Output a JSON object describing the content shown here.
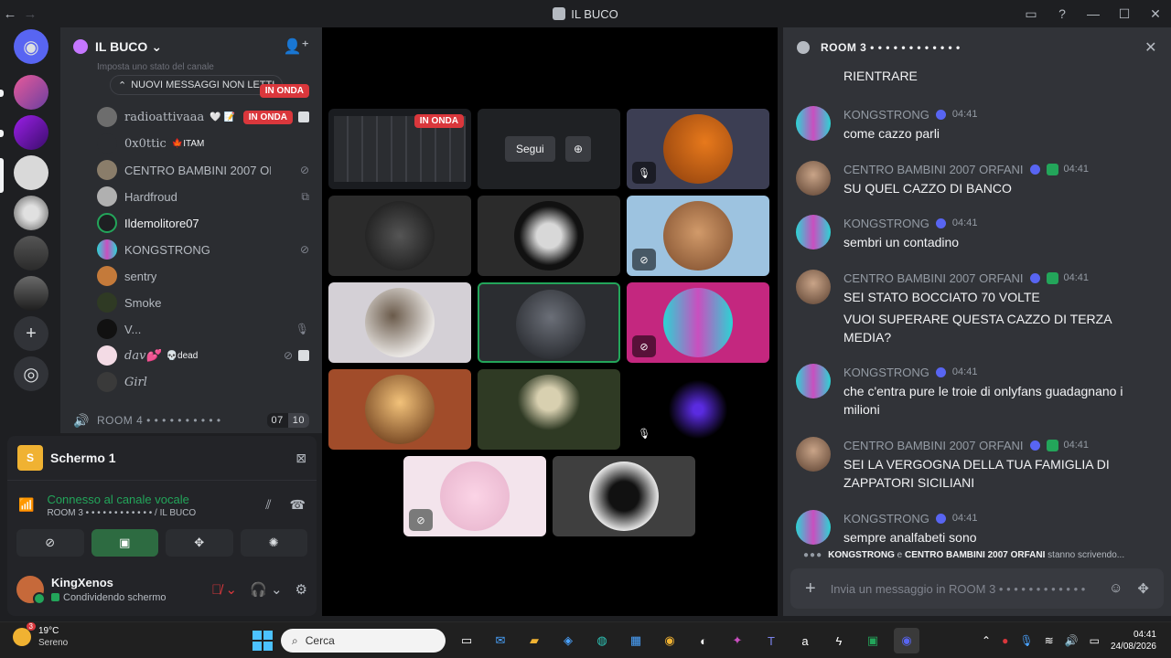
{
  "window": {
    "title": "IL BUCO",
    "controls": [
      "inbox-icon",
      "help-icon",
      "minimize-icon",
      "maximize-icon",
      "close-icon"
    ]
  },
  "server": {
    "name": "IL BUCO",
    "topic_hint": "Imposta uno stato del canale",
    "unread_pill": "NUOVI MESSAGGI NON LETTI"
  },
  "members": [
    {
      "name": "",
      "live": "IN ONDA"
    },
    {
      "name": "radioattivaaa",
      "badge": "🤍 📝",
      "live": "IN ONDA"
    },
    {
      "name": "0x0ttic",
      "badge": "🍁ITAM"
    },
    {
      "name": "CENTRO BAMBINI 2007 ORFA...",
      "icon": "muted-mic-icon"
    },
    {
      "name": "Hardfroud",
      "icon": "playstation-icon"
    },
    {
      "name": "Ildemolitore07"
    },
    {
      "name": "KONGSTRONG",
      "icon": "muted-mic-icon"
    },
    {
      "name": "sentry"
    },
    {
      "name": "Smoke"
    },
    {
      "name": "V...",
      "icon": "mic-icon"
    },
    {
      "name": "dav💕",
      "badge": "💀dead",
      "icon": "muted-mic-icon"
    },
    {
      "name": "Girl"
    }
  ],
  "room4": {
    "label": "ROOM 4 • • • • • • • • • •",
    "count_a": "07",
    "count_b": "10"
  },
  "screen_share": {
    "icon_letter": "S",
    "title": "Schermo 1"
  },
  "voice": {
    "status": "Connesso al canale vocale",
    "channel": "ROOM 3 • • • • • • • • • • • • / IL BUCO"
  },
  "user": {
    "name": "KingXenos",
    "status": "Condividendo schermo"
  },
  "stage": {
    "live_label": "IN ONDA",
    "follow_label": "Segui"
  },
  "chat": {
    "title": "ROOM 3 • • • • • • • • • • • •",
    "first_line": "RIENTRARE",
    "messages": [
      {
        "author": "KONGSTRONG",
        "time": "04:41",
        "lines": [
          "come cazzo parli"
        ],
        "kind": "kong"
      },
      {
        "author": "CENTRO BAMBINI 2007 ORFANI",
        "time": "04:41",
        "lines": [
          "SU QUEL CAZZO DI BANCO"
        ],
        "kind": "centro"
      },
      {
        "author": "KONGSTRONG",
        "time": "04:41",
        "lines": [
          "sembri un contadino"
        ],
        "kind": "kong"
      },
      {
        "author": "CENTRO BAMBINI 2007 ORFANI",
        "time": "04:41",
        "lines": [
          "SEI STATO BOCCIATO 70 VOLTE",
          "VUOI SUPERARE QUESTA CAZZO DI TERZA MEDIA?"
        ],
        "kind": "centro"
      },
      {
        "author": "KONGSTRONG",
        "time": "04:41",
        "lines": [
          "che c'entra pure le troie di onlyfans guadagnano i milioni"
        ],
        "kind": "kong"
      },
      {
        "author": "CENTRO BAMBINI 2007 ORFANI",
        "time": "04:41",
        "lines": [
          "SEI LA VERGOGNA DELLA TUA FAMIGLIA DI ZAPPATORI SICILIANI"
        ],
        "kind": "centro"
      },
      {
        "author": "KONGSTRONG",
        "time": "04:41",
        "lines": [
          "sempre analfabeti sono"
        ],
        "kind": "kong"
      }
    ],
    "typing": {
      "user1": "KONGSTRONG",
      "joiner": " e ",
      "user2": "CENTRO BAMBINI 2007 ORFANI",
      "suffix": " stanno scrivendo..."
    },
    "composer_placeholder": "Invia un messaggio in ROOM 3 • • • • • • • • • • • •"
  },
  "taskbar": {
    "weather_badge": "3",
    "temperature": "19°C",
    "condition": "Sereno",
    "search_placeholder": "Cerca",
    "time": "04:41",
    "date": "24/08/2026"
  }
}
